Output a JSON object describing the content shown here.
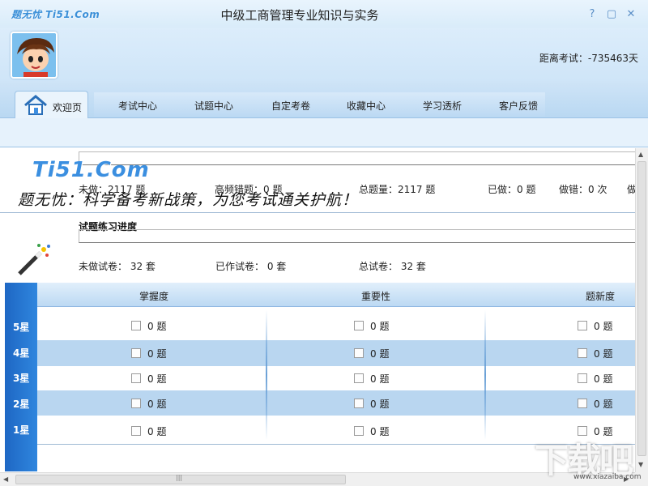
{
  "titlebar": {
    "logo": "题无忧 Ti51.Com",
    "title": "中级工商管理专业知识与实务",
    "window_buttons": {
      "help": "?",
      "minimize": "▢",
      "close": "✕"
    }
  },
  "header": {
    "countdown": "距离考试：-735463天"
  },
  "nav": {
    "home_label": "欢迎页",
    "items": [
      "考试中心",
      "试题中心",
      "自定考卷",
      "收藏中心",
      "学习透析",
      "客户反馈"
    ]
  },
  "summary": {
    "logo": "Ti51.Com",
    "slogan": "题无忧：科学备考新战策，为您考试通关护航！",
    "stats": [
      "未做：2117 题",
      "高频错题：0 题",
      "总题量：2117 题",
      "已做：0 题",
      "做错：0 次",
      "做"
    ]
  },
  "progress": {
    "title": "试题练习进度",
    "stats": [
      "未做试卷：  32 套",
      "已作试卷：  0 套",
      "总试卷：  32 套"
    ]
  },
  "table": {
    "headers": [
      "掌握度",
      "重要性",
      "题新度"
    ],
    "rows": [
      {
        "star": "5星",
        "cells": [
          "0 题",
          "0 题",
          "0 题"
        ]
      },
      {
        "star": "4星",
        "cells": [
          "0 题",
          "0 题",
          "0 题"
        ]
      },
      {
        "star": "3星",
        "cells": [
          "0 题",
          "0 题",
          "0 题"
        ]
      },
      {
        "star": "2星",
        "cells": [
          "0 题",
          "0 题",
          "0 题"
        ]
      },
      {
        "star": "1星",
        "cells": [
          "0 题",
          "0 题",
          "0 题"
        ]
      }
    ]
  },
  "watermark": {
    "text": "下载吧",
    "url": "www.xiazaiba.com"
  },
  "colors": {
    "accent": "#2f86de",
    "row_alt": "#b9d6f0",
    "header_bg": "#cfe5f8"
  },
  "icons": [
    "home-icon",
    "avatar-cartoon",
    "magic-wand-icon"
  ]
}
